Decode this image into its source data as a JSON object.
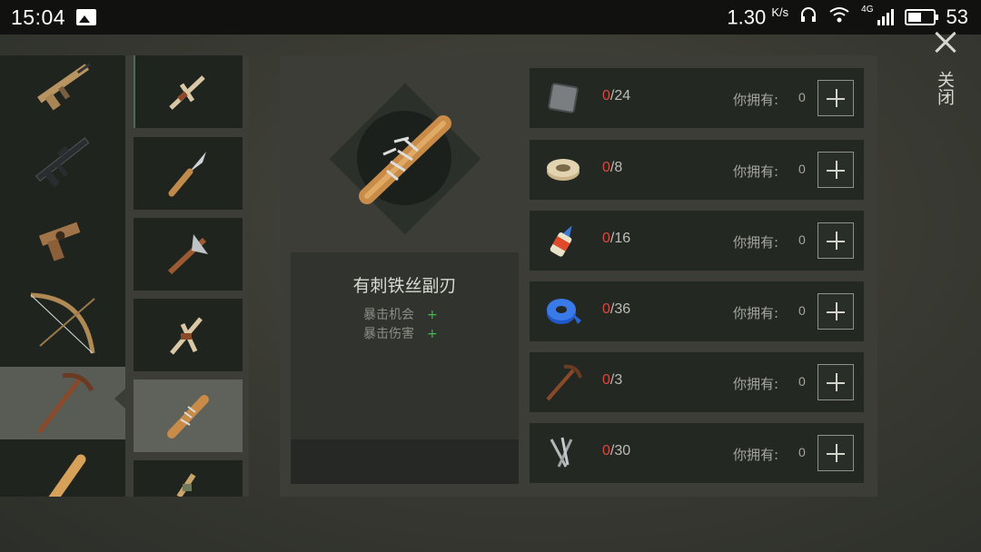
{
  "status_bar": {
    "time": "15:04",
    "speed": "1.30",
    "speed_unit": "K/s",
    "network": "4G",
    "battery_percent": "53",
    "battery_level": 0.53
  },
  "weapon_categories": [
    {
      "name": "assault-rifle"
    },
    {
      "name": "rifle"
    },
    {
      "name": "pistol"
    },
    {
      "name": "bow"
    },
    {
      "name": "melee",
      "selected": true
    },
    {
      "name": "bat"
    }
  ],
  "crafting_items": [
    {
      "name": "bone-pick"
    },
    {
      "name": "knife"
    },
    {
      "name": "axe"
    },
    {
      "name": "bone-tool"
    },
    {
      "name": "barbed-bat",
      "selected": true
    },
    {
      "name": "club"
    }
  ],
  "selected_item": {
    "name": "有刺铁丝副刃",
    "stats": [
      {
        "label": "暴击机会",
        "value": "+"
      },
      {
        "label": "暴击伤害",
        "value": "+"
      }
    ]
  },
  "materials": [
    {
      "icon": "metal-plate-icon",
      "have_now": "0",
      "required": "/24",
      "owned_label": "你拥有:",
      "owned": "0"
    },
    {
      "icon": "wire-spool-icon",
      "have_now": "0",
      "required": "/8",
      "owned_label": "你拥有:",
      "owned": "0"
    },
    {
      "icon": "glue-bottle-icon",
      "have_now": "0",
      "required": "/16",
      "owned_label": "你拥有:",
      "owned": "0"
    },
    {
      "icon": "duct-tape-icon",
      "have_now": "0",
      "required": "/36",
      "owned_label": "你拥有:",
      "owned": "0"
    },
    {
      "icon": "pickaxe-icon",
      "have_now": "0",
      "required": "/3",
      "owned_label": "你拥有:",
      "owned": "0"
    },
    {
      "icon": "nails-icon",
      "have_now": "0",
      "required": "/30",
      "owned_label": "你拥有:",
      "owned": "0"
    }
  ],
  "close_label": "关闭",
  "colors": {
    "accent_plus": "#3fbf4a",
    "missing_count": "#e0453a",
    "panel": "#3b3d36",
    "slot": "#20241f"
  }
}
